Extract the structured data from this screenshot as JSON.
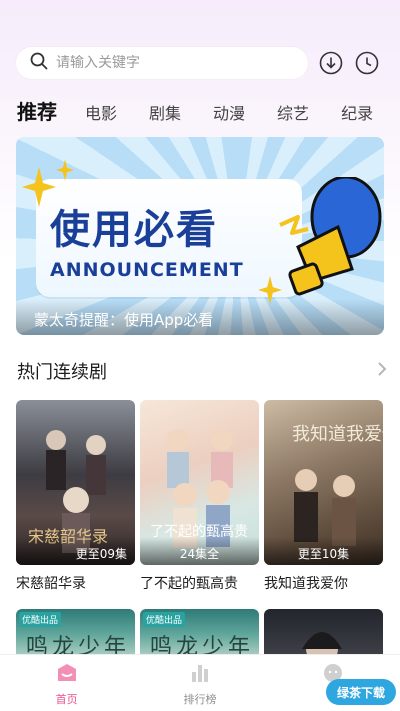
{
  "search": {
    "placeholder": "请输入关键字"
  },
  "header_icons": [
    "download-icon",
    "history-clock-icon"
  ],
  "tabs": [
    {
      "label": "推荐",
      "active": true
    },
    {
      "label": "电影"
    },
    {
      "label": "剧集"
    },
    {
      "label": "动漫"
    },
    {
      "label": "综艺"
    },
    {
      "label": "纪录"
    }
  ],
  "banner": {
    "title": "使用必看",
    "subtitle": "ANNOUNCEMENT",
    "caption": "蒙太奇提醒：使用App必看"
  },
  "section": {
    "title": "热门连续剧"
  },
  "dramas": [
    {
      "title": "宋慈韶华录",
      "badge": "更至09集"
    },
    {
      "title": "了不起的甄高贵",
      "badge": "24集全"
    },
    {
      "title": "我知道我爱你",
      "badge": "更至10集"
    }
  ],
  "second_row": [
    {
      "tag": "优酷出品",
      "text": "鸣龙少年"
    },
    {
      "tag": "优酷出品",
      "text": "鸣龙少年"
    },
    {
      "tag": "",
      "text": ""
    }
  ],
  "bottom_nav": [
    {
      "label": "首页",
      "active": true
    },
    {
      "label": "排行榜"
    },
    {
      "label": ""
    }
  ],
  "watermark": "绿茶下载",
  "colors": {
    "accent": "#e8548e",
    "banner_text": "#1a3f98"
  }
}
